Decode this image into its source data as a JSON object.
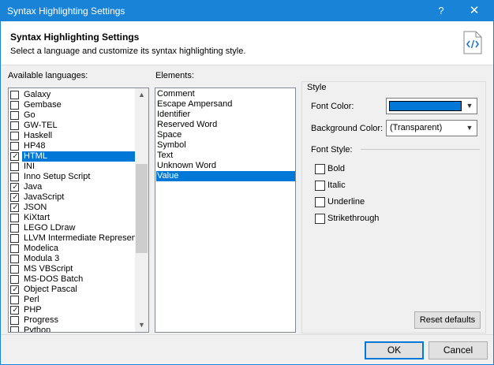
{
  "window": {
    "title": "Syntax Highlighting Settings",
    "help_label": "?",
    "close_label": "✕"
  },
  "header": {
    "title": "Syntax Highlighting Settings",
    "subtitle": "Select a language and customize its syntax highlighting style.",
    "icon": "code-file-icon"
  },
  "languages": {
    "label": "Available languages:",
    "items": [
      {
        "label": "Galaxy",
        "checked": false
      },
      {
        "label": "Gembase",
        "checked": false
      },
      {
        "label": "Go",
        "checked": false
      },
      {
        "label": "GW-TEL",
        "checked": false
      },
      {
        "label": "Haskell",
        "checked": false
      },
      {
        "label": "HP48",
        "checked": false
      },
      {
        "label": "HTML",
        "checked": true,
        "selected": true
      },
      {
        "label": "INI",
        "checked": false
      },
      {
        "label": "Inno Setup Script",
        "checked": false
      },
      {
        "label": "Java",
        "checked": true
      },
      {
        "label": "JavaScript",
        "checked": true
      },
      {
        "label": "JSON",
        "checked": true
      },
      {
        "label": "KiXtart",
        "checked": false
      },
      {
        "label": "LEGO LDraw",
        "checked": false
      },
      {
        "label": "LLVM Intermediate Represent",
        "checked": false
      },
      {
        "label": "Modelica",
        "checked": false
      },
      {
        "label": "Modula 3",
        "checked": false
      },
      {
        "label": "MS VBScript",
        "checked": false
      },
      {
        "label": "MS-DOS Batch",
        "checked": false
      },
      {
        "label": "Object Pascal",
        "checked": true
      },
      {
        "label": "Perl",
        "checked": false
      },
      {
        "label": "PHP",
        "checked": true
      },
      {
        "label": "Progress",
        "checked": false
      },
      {
        "label": "Python",
        "checked": false
      }
    ]
  },
  "elements": {
    "label": "Elements:",
    "items": [
      "Comment",
      "Escape Ampersand",
      "Identifier",
      "Reserved Word",
      "Space",
      "Symbol",
      "Text",
      "Unknown Word",
      "Value"
    ],
    "selected_index": 8
  },
  "style": {
    "group_title": "Style",
    "font_color_label": "Font Color:",
    "font_color_value": "#0078d7",
    "background_color_label": "Background Color:",
    "background_color_value": "(Transparent)",
    "font_style_label": "Font Style:",
    "bold_label": "Bold",
    "italic_label": "Italic",
    "underline_label": "Underline",
    "strikethrough_label": "Strikethrough",
    "reset_label": "Reset defaults"
  },
  "buttons": {
    "ok_label": "OK",
    "cancel_label": "Cancel"
  },
  "colors": {
    "accent": "#0078d7",
    "titlebar": "#1883d7"
  }
}
